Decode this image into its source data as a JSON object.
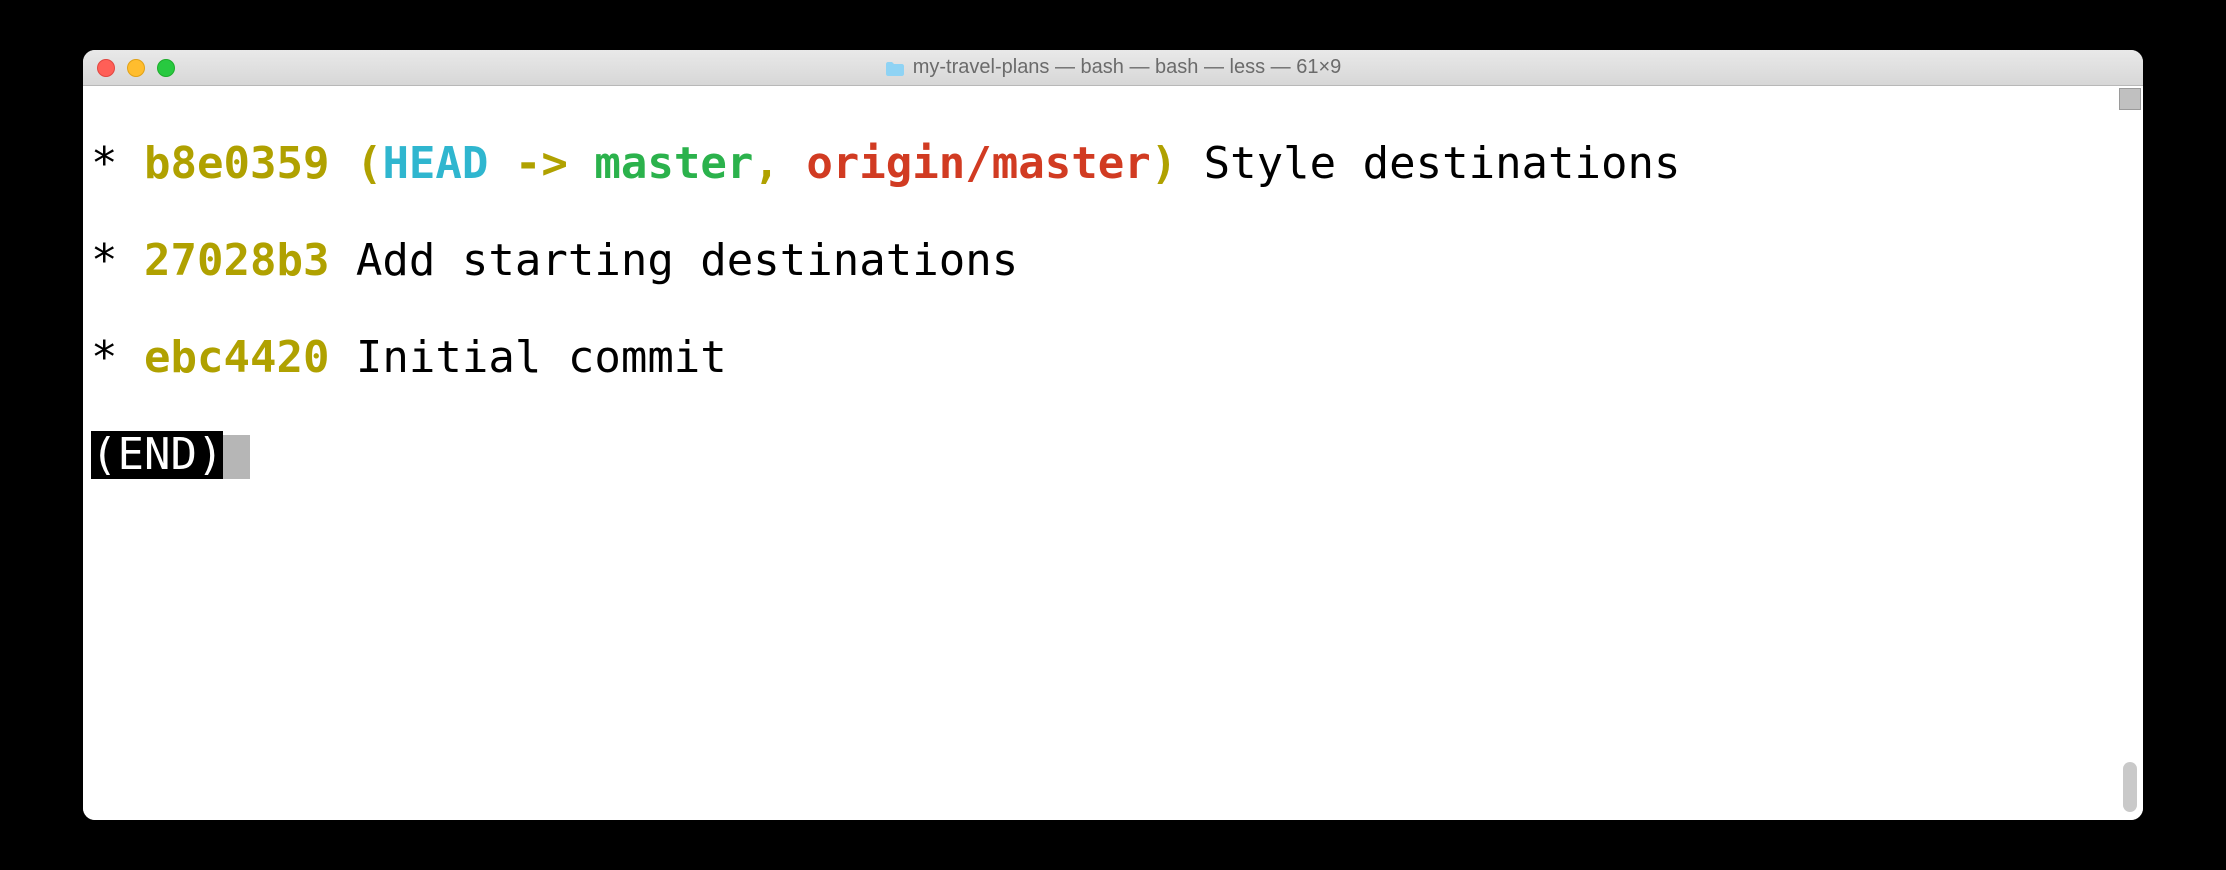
{
  "window": {
    "title": "my-travel-plans — bash — bash — less — 61×9"
  },
  "git_log": {
    "commits": [
      {
        "graph": "*",
        "hash": "b8e0359",
        "refs": {
          "open": "(",
          "head": "HEAD",
          "arrow": " -> ",
          "branch": "master",
          "comma": ", ",
          "remote": "origin/master",
          "close": ")"
        },
        "message": " Style destinations"
      },
      {
        "graph": "*",
        "hash": "27028b3",
        "message": " Add starting destinations"
      },
      {
        "graph": "*",
        "hash": "ebc4420",
        "message": " Initial commit"
      }
    ],
    "end_marker": "(END)"
  },
  "colors": {
    "hash": "#b0a100",
    "head": "#2fb6cf",
    "branch": "#2bb24c",
    "remote": "#d13b22",
    "bg": "#ffffff",
    "fg": "#000000"
  }
}
